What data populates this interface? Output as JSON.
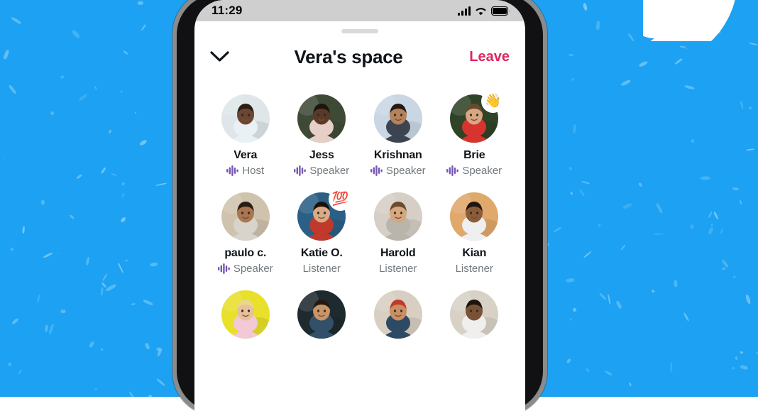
{
  "background": {
    "color": "#1DA1F2",
    "logo": "twitter-bird-logo"
  },
  "phone": {
    "statusbar": {
      "time": "11:29",
      "icons": [
        "cellular-signal-icon",
        "wifi-icon",
        "battery-icon"
      ]
    }
  },
  "header": {
    "back_icon": "chevron-down-icon",
    "title": "Vera's space",
    "leave_label": "Leave",
    "leave_color": "#E0245E",
    "grabber": "drag-handle"
  },
  "accent": {
    "waveform_color": "#7856B5",
    "name_color": "#0f1419",
    "role_color": "#71797e"
  },
  "participants": [
    {
      "name": "Vera",
      "role": "Host",
      "speaking": true,
      "badge": "",
      "row": 1
    },
    {
      "name": "Jess",
      "role": "Speaker",
      "speaking": true,
      "badge": "",
      "row": 1
    },
    {
      "name": "Krishnan",
      "role": "Speaker",
      "speaking": true,
      "badge": "",
      "row": 1
    },
    {
      "name": "Brie",
      "role": "Speaker",
      "speaking": true,
      "badge": "👋",
      "row": 1
    },
    {
      "name": "paulo c.",
      "role": "Speaker",
      "speaking": true,
      "badge": "",
      "row": 2
    },
    {
      "name": "Katie O.",
      "role": "Listener",
      "speaking": false,
      "badge": "💯",
      "row": 2
    },
    {
      "name": "Harold",
      "role": "Listener",
      "speaking": false,
      "badge": "",
      "row": 2
    },
    {
      "name": "Kian",
      "role": "Listener",
      "speaking": false,
      "badge": "",
      "row": 2
    },
    {
      "name": "",
      "role": "",
      "speaking": false,
      "badge": "",
      "row": 3
    },
    {
      "name": "",
      "role": "",
      "speaking": false,
      "badge": "",
      "row": 3
    },
    {
      "name": "",
      "role": "",
      "speaking": false,
      "badge": "",
      "row": 3
    },
    {
      "name": "",
      "role": "",
      "speaking": false,
      "badge": "",
      "row": 3
    }
  ]
}
